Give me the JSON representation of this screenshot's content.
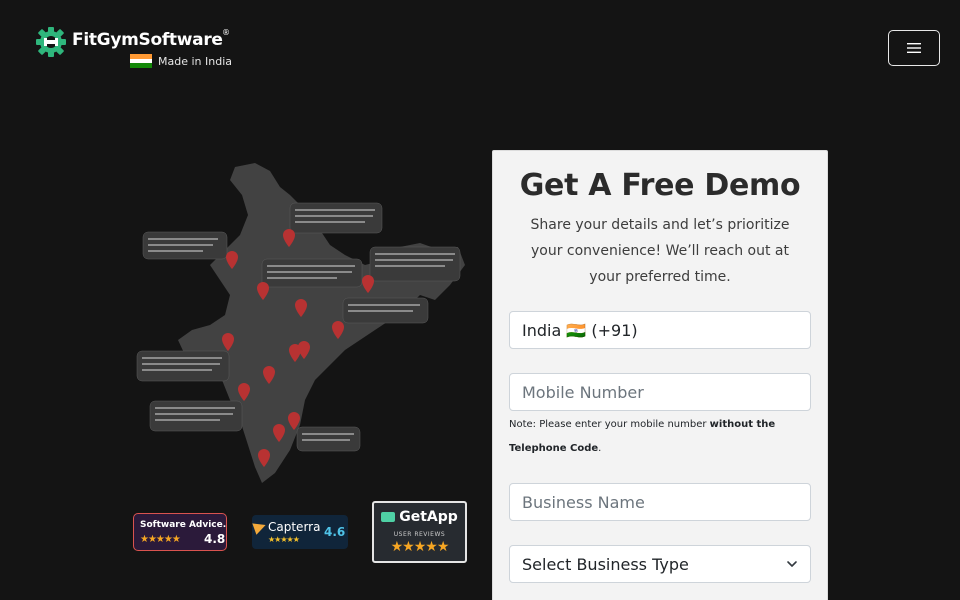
{
  "brand": {
    "name": "FitGymSoftware",
    "registered_mark": "®",
    "tagline": "Made in India"
  },
  "nav": {
    "menu_icon": "hamburger-icon"
  },
  "map": {
    "icon": "india-map-illustration",
    "pin_color": "#c9302c"
  },
  "badges": {
    "software_advice": {
      "label": "Software Advice.",
      "rating": "4.8",
      "stars": "★★★★★"
    },
    "capterra": {
      "label": "Capterra",
      "rating": "4.6",
      "stars": "★★★★★"
    },
    "getapp": {
      "label": "GetApp",
      "sub": "USER REVIEWS",
      "stars": "★★★★★"
    }
  },
  "demo": {
    "title": "Get A Free Demo",
    "description": "Share your details and let’s prioritize your convenience! We’ll reach out at your preferred time.",
    "country_value": "India 🇮🇳 (+91)",
    "mobile_placeholder": "Mobile Number",
    "note_prefix": "Note: Please enter your mobile number ",
    "note_bold": "without the Telephone Code",
    "note_suffix": ".",
    "business_placeholder": "Business Name",
    "business_type_value": "Select Business Type"
  },
  "colors": {
    "background": "#141414",
    "card": "#f3f3f3",
    "accent_green": "#2fb67c"
  }
}
